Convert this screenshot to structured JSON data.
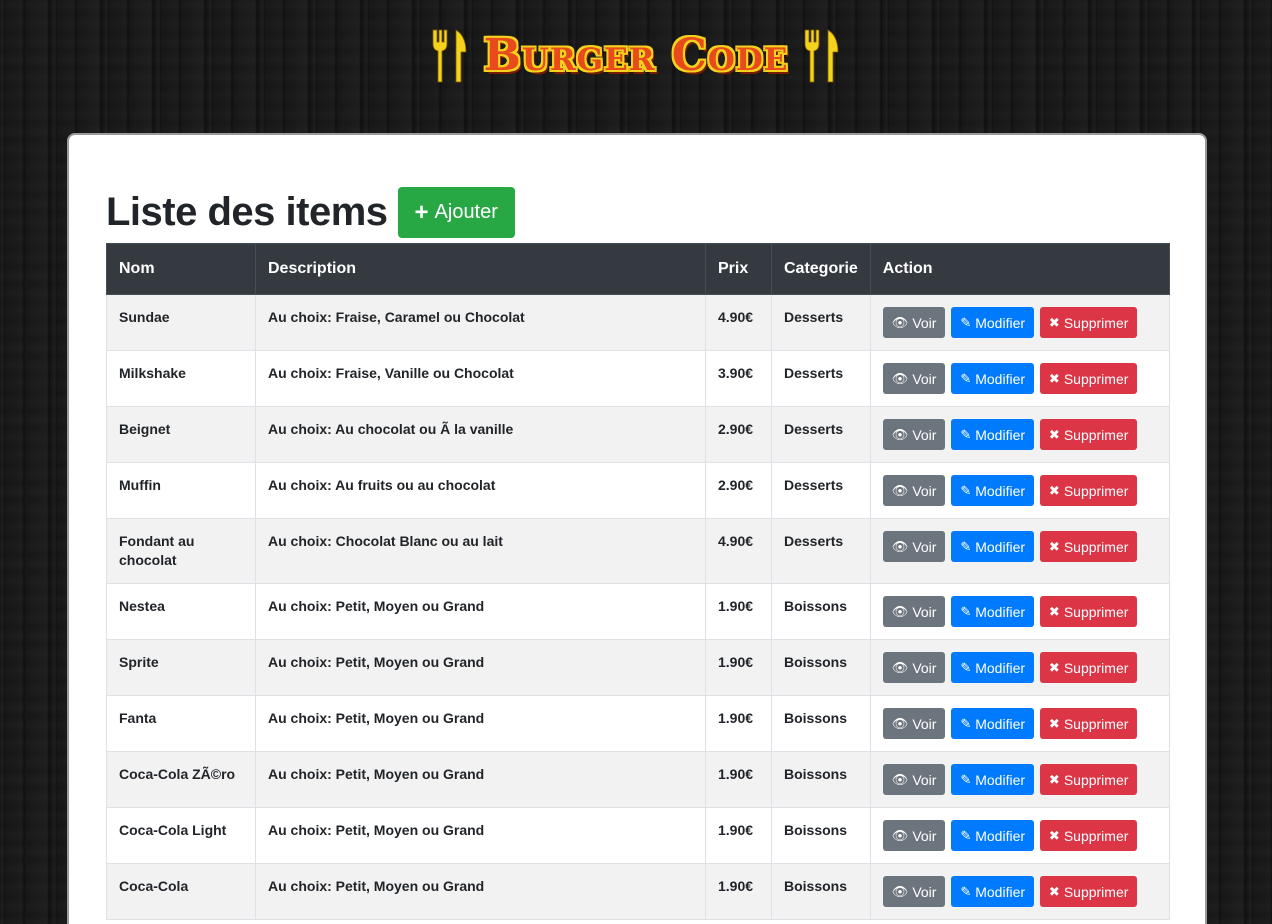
{
  "brand": {
    "title": "Burger Code"
  },
  "page": {
    "title": "Liste des items",
    "add_label": "Ajouter"
  },
  "table": {
    "headers": [
      "Nom",
      "Description",
      "Prix",
      "Categorie",
      "Action"
    ],
    "actions": {
      "view": "Voir",
      "edit": "Modifier",
      "delete": "Supprimer"
    },
    "rows": [
      {
        "nom": "Sundae",
        "description": "Au choix: Fraise, Caramel ou Chocolat",
        "prix": "4.90€",
        "categorie": "Desserts"
      },
      {
        "nom": "Milkshake",
        "description": "Au choix: Fraise, Vanille ou Chocolat",
        "prix": "3.90€",
        "categorie": "Desserts"
      },
      {
        "nom": "Beignet",
        "description": "Au choix: Au chocolat ou Ã  la vanille",
        "prix": "2.90€",
        "categorie": "Desserts"
      },
      {
        "nom": "Muffin",
        "description": "Au choix: Au fruits ou au chocolat",
        "prix": "2.90€",
        "categorie": "Desserts"
      },
      {
        "nom": "Fondant au chocolat",
        "description": "Au choix: Chocolat Blanc ou au lait",
        "prix": "4.90€",
        "categorie": "Desserts"
      },
      {
        "nom": "Nestea",
        "description": "Au choix: Petit, Moyen ou Grand",
        "prix": "1.90€",
        "categorie": "Boissons"
      },
      {
        "nom": "Sprite",
        "description": "Au choix: Petit, Moyen ou Grand",
        "prix": "1.90€",
        "categorie": "Boissons"
      },
      {
        "nom": "Fanta",
        "description": "Au choix: Petit, Moyen ou Grand",
        "prix": "1.90€",
        "categorie": "Boissons"
      },
      {
        "nom": "Coca-Cola ZÃ©ro",
        "description": "Au choix: Petit, Moyen ou Grand",
        "prix": "1.90€",
        "categorie": "Boissons"
      },
      {
        "nom": "Coca-Cola Light",
        "description": "Au choix: Petit, Moyen ou Grand",
        "prix": "1.90€",
        "categorie": "Boissons"
      },
      {
        "nom": "Coca-Cola",
        "description": "Au choix: Petit, Moyen ou Grand",
        "prix": "1.90€",
        "categorie": "Boissons"
      }
    ]
  },
  "colors": {
    "add": "#28a745",
    "view": "#6c757d",
    "edit": "#007bff",
    "delete": "#dc3545",
    "header_bg": "#343a40",
    "brand_red": "#e8491d",
    "brand_yellow": "#f5d21b"
  },
  "icons": {
    "brand": "fork-knife-icon",
    "add": "plus-icon",
    "view": "eye-icon",
    "edit": "pencil-icon",
    "delete": "x-icon"
  }
}
